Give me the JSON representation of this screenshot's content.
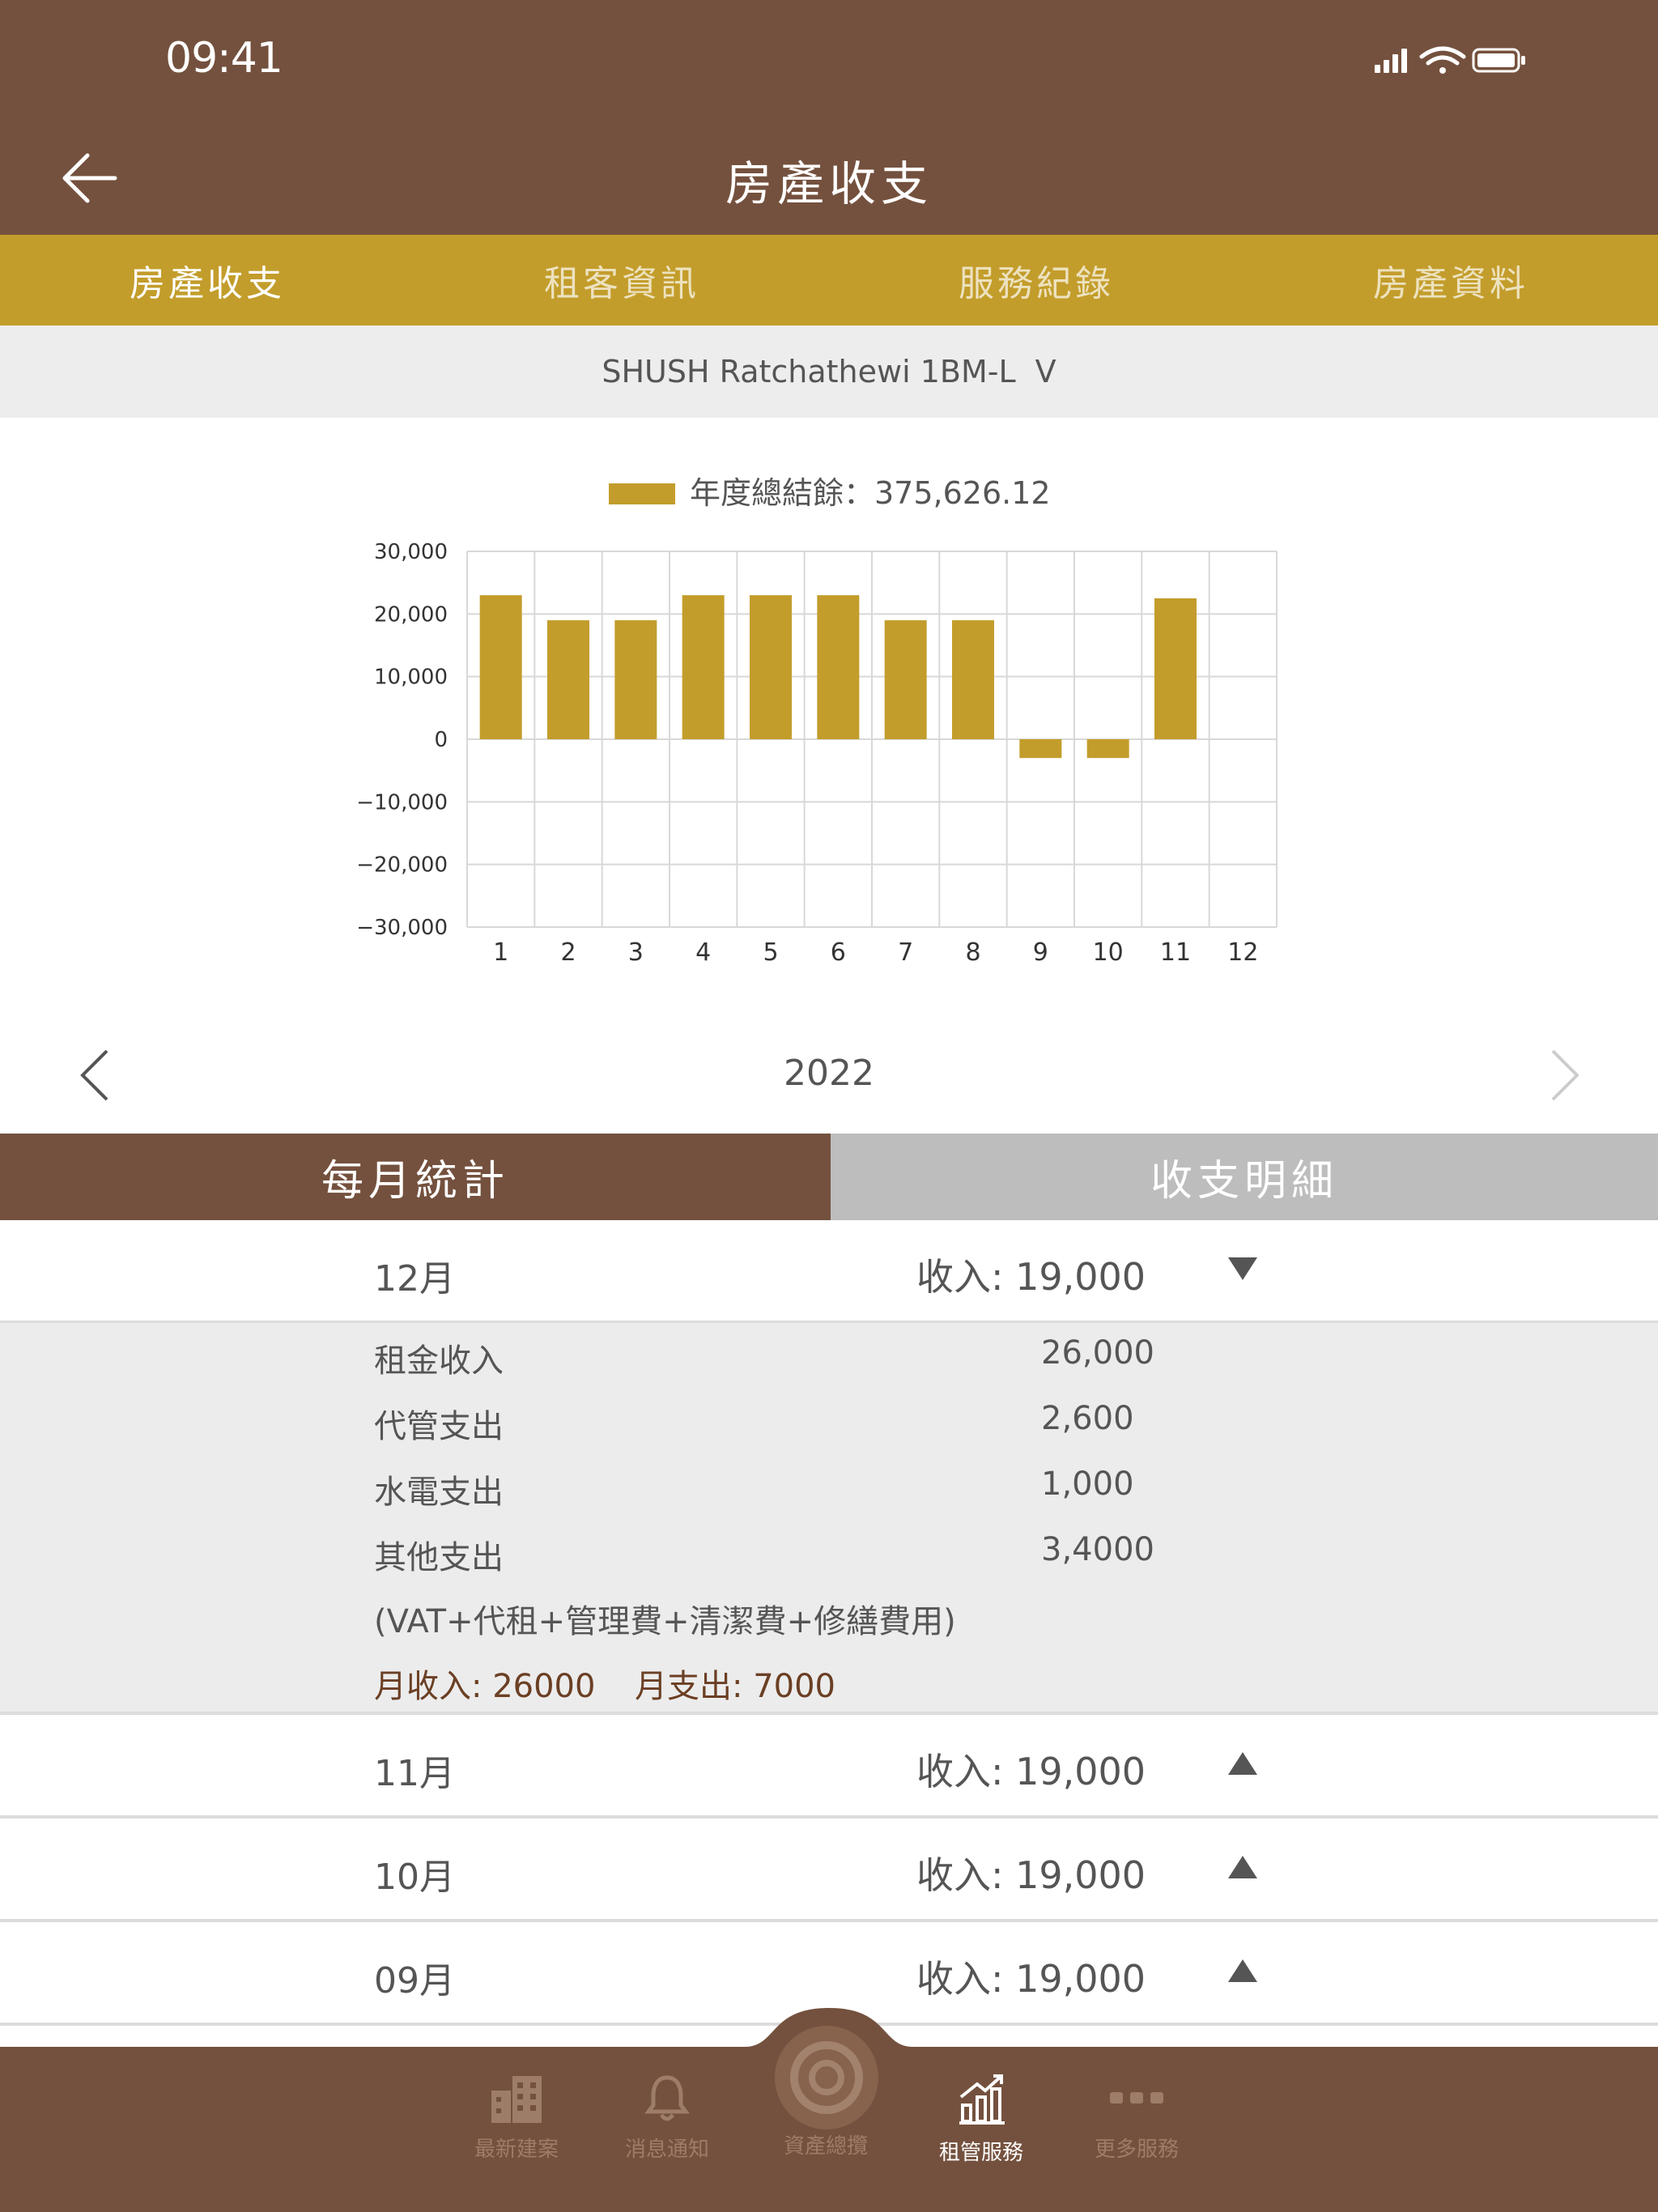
{
  "status_bar": {
    "time": "09:41"
  },
  "header": {
    "title": "房產收支",
    "back_icon": "arrow-left-icon"
  },
  "tabs": [
    {
      "label": "房產收支",
      "active": true
    },
    {
      "label": "租客資訊",
      "active": false
    },
    {
      "label": "服務紀錄",
      "active": false
    },
    {
      "label": "房產資料",
      "active": false
    }
  ],
  "property_selector": {
    "value": "SHUSH Ratchathewi 1BM-L",
    "chevron": "V"
  },
  "legend": {
    "label": "年度總結餘：375,626.12",
    "color": "#c39d2b"
  },
  "chart_data": {
    "type": "bar",
    "categories": [
      "1",
      "2",
      "3",
      "4",
      "5",
      "6",
      "7",
      "8",
      "9",
      "10",
      "11",
      "12"
    ],
    "series": [
      {
        "name": "年度總結餘：375,626.12",
        "values": [
          23000,
          19000,
          19000,
          23000,
          23000,
          23000,
          19000,
          19000,
          -3000,
          -3000,
          22500,
          0
        ]
      }
    ],
    "ytick_labels": [
      "30,000",
      "20,000",
      "10,000",
      "0",
      "−10,000",
      "−20,000",
      "−30,000"
    ],
    "ylim": [
      -30000,
      30000
    ],
    "grid": true,
    "bar_color": "#c39d2b"
  },
  "year_nav": {
    "year": "2022"
  },
  "segments": {
    "monthly": "每月統計",
    "detail": "收支明細"
  },
  "months": [
    {
      "label": "12月",
      "income": "收入: 19,000",
      "expanded": true
    },
    {
      "label": "11月",
      "income": "收入: 19,000",
      "expanded": false
    },
    {
      "label": "10月",
      "income": "收入: 19,000",
      "expanded": false
    },
    {
      "label": "09月",
      "income": "收入: 19,000",
      "expanded": false
    }
  ],
  "details": {
    "items": [
      {
        "label": "租金收入",
        "value": "26,000"
      },
      {
        "label": "代管支出",
        "value": "2,600"
      },
      {
        "label": "水電支出",
        "value": "1,000"
      },
      {
        "label": "其他支出",
        "value": "3,4000"
      }
    ],
    "note": "(VAT+代租+管理費+清潔費+修繕費用)",
    "monthly_income": "月收入: 26000",
    "monthly_expense": "月支出: 7000"
  },
  "bottom_nav": [
    {
      "label": "最新建案",
      "icon": "building-icon"
    },
    {
      "label": "消息通知",
      "icon": "bell-icon"
    },
    {
      "label": "資產總攬",
      "icon": "asset-center-icon"
    },
    {
      "label": "租管服務",
      "icon": "chart-up-icon",
      "active": true
    },
    {
      "label": "更多服務",
      "icon": "more-dots-icon"
    }
  ]
}
